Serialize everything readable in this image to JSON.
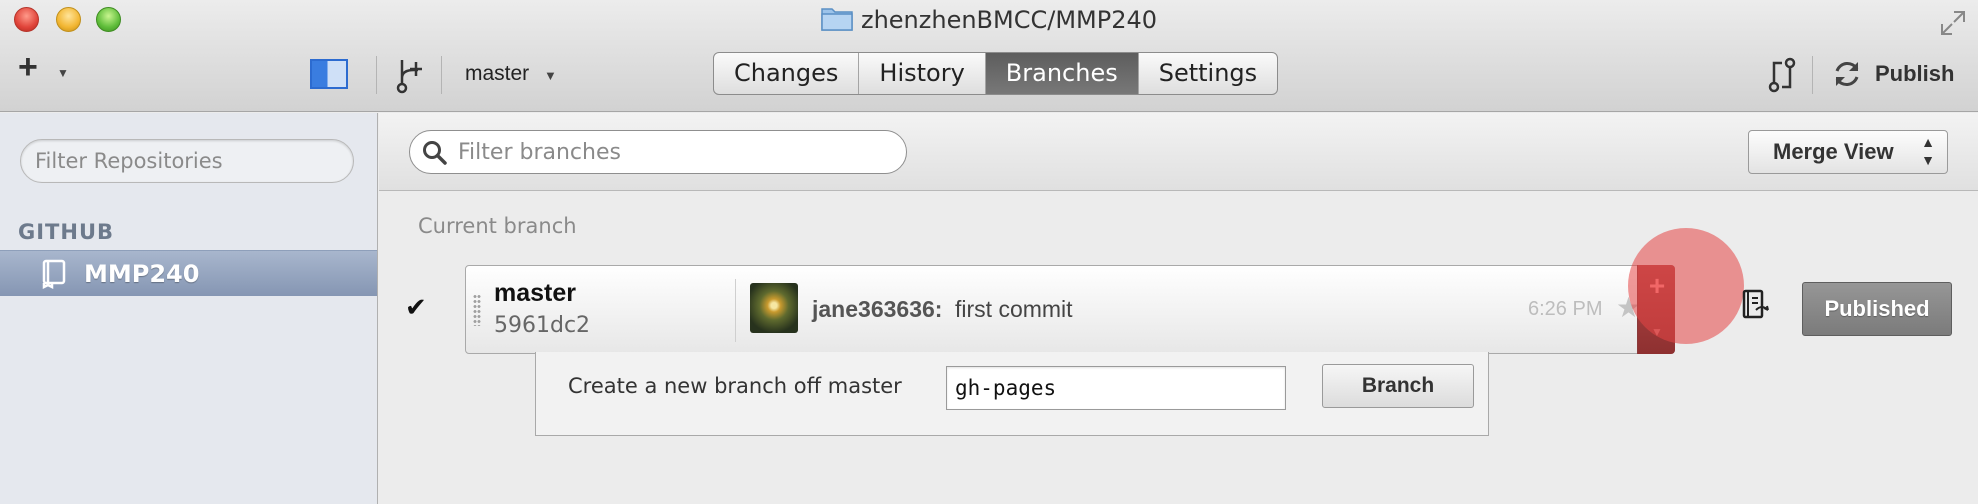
{
  "window": {
    "title": "zhenzhenBMCC/MMP240"
  },
  "toolbar": {
    "current_branch": "master",
    "tabs": [
      {
        "label": "Changes",
        "active": false
      },
      {
        "label": "History",
        "active": false
      },
      {
        "label": "Branches",
        "active": true
      },
      {
        "label": "Settings",
        "active": false
      }
    ],
    "publish_label": "Publish"
  },
  "sidebar": {
    "filter_placeholder": "Filter Repositories",
    "section_header": "GITHUB",
    "repos": [
      {
        "name": "MMP240",
        "selected": true
      }
    ]
  },
  "main": {
    "filter_placeholder": "Filter branches",
    "merge_view_label": "Merge View",
    "section_title": "Current branch",
    "current_branch": {
      "name": "master",
      "sha": "5961dc2",
      "commit_author": "jane363636:",
      "commit_message": "first commit",
      "commit_time": "6:26 PM",
      "published_label": "Published"
    },
    "new_branch": {
      "label": "Create a new branch off master",
      "input_value": "gh-pages",
      "button_label": "Branch"
    }
  },
  "icons": {
    "traffic_lights": [
      "close-icon",
      "minimize-icon",
      "zoom-icon"
    ],
    "toolbar": [
      "plus-icon",
      "sidebar-toggle-icon",
      "branch-icon",
      "compare-icon",
      "sync-icon",
      "fullscreen-icon",
      "folder-icon"
    ],
    "sidebar": [
      "repo-book-icon"
    ],
    "main": [
      "search-icon",
      "checkmark-icon",
      "drag-handle-icon",
      "star-icon",
      "add-branch-icon",
      "caret-down-icon",
      "notes-icon"
    ]
  },
  "colors": {
    "active_tab": "#6b6b6b",
    "selected_repo": "#8e9fba",
    "accent_blue": "#2c6bd0",
    "add_branch_button": "#a63c3c",
    "click_highlight": "#e64646"
  }
}
